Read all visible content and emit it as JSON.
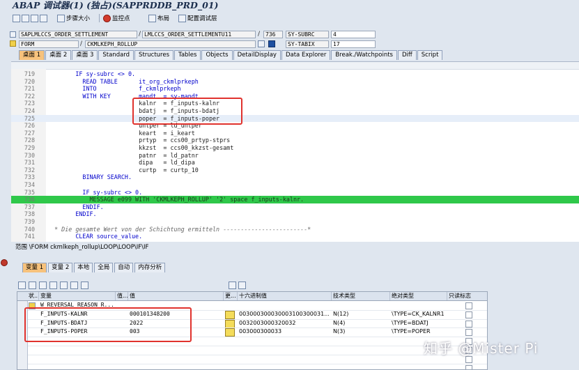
{
  "window": {
    "title": "ABAP 调试器(1) (独占)(SAPPRDDB_PRD_01)"
  },
  "toolbar": {
    "step_size": "步骤大小",
    "watchpoint": "监控点",
    "layout": "布局",
    "config_layer": "配置调试层"
  },
  "fields": {
    "program": "SAPLMLCCS_ORDER_SETTLEMENT",
    "include": "LMLCCS_ORDER_SETTLEMENTU11",
    "line": "736",
    "sysubrc_label": "SY-SUBRC",
    "sysubrc_value": "4",
    "event_type": "FORM",
    "event_name": "CKMLKEPH_ROLLUP",
    "sytabix_label": "SY-TABIX",
    "sytabix_value": "17"
  },
  "tabs": [
    "桌面 1",
    "桌面 2",
    "桌面 3",
    "Standard",
    "Structures",
    "Tables",
    "Objects",
    "DetailDisplay",
    "Data Explorer",
    "Break./Watchpoints",
    "Diff",
    "Script"
  ],
  "code_lines": [
    {
      "n": "719",
      "text": "        IF sy-subrc <> 0."
    },
    {
      "n": "720",
      "text": "          READ TABLE      it_org_ckmlprkeph"
    },
    {
      "n": "721",
      "text": "          INTO            f_ckmlprkeph"
    },
    {
      "n": "722",
      "text": "          WITH KEY        mandt  = sy-mandt"
    },
    {
      "n": "723",
      "text": "                          kalnr  = f_inputs-kalnr"
    },
    {
      "n": "724",
      "text": "                          bdatj  = f_inputs-bdatj"
    },
    {
      "n": "725",
      "text": "                          poper  = f_inputs-poper"
    },
    {
      "n": "726",
      "text": "                          untper = ld_untper"
    },
    {
      "n": "727",
      "text": "                          keart  = i_keart"
    },
    {
      "n": "728",
      "text": "                          prtyp  = ccs00_prtyp-stprs"
    },
    {
      "n": "729",
      "text": "                          kkzst  = ccs00_kkzst-gesamt"
    },
    {
      "n": "730",
      "text": "                          patnr  = ld_patnr"
    },
    {
      "n": "731",
      "text": "                          dipa   = ld_dipa"
    },
    {
      "n": "732",
      "text": "                          curtp  = curtp_10"
    },
    {
      "n": "733",
      "text": "          BINARY SEARCH."
    },
    {
      "n": "734",
      "text": ""
    },
    {
      "n": "735",
      "text": "          IF sy-subrc <> 0."
    },
    {
      "n": "736",
      "text": "            MESSAGE e099 WITH 'CKMLKEPH_ROLLUP' '2' space f_inputs-kalnr."
    },
    {
      "n": "737",
      "text": "          ENDIF."
    },
    {
      "n": "738",
      "text": "        ENDIF."
    },
    {
      "n": "739",
      "text": ""
    },
    {
      "n": "740",
      "text": "  * Die gesamte Wert von der Schichtung ermitteln ------------------------*"
    },
    {
      "n": "741",
      "text": "        CLEAR source_value."
    }
  ],
  "status": {
    "scope": "范围 \\FORM ckmlkeph_rollup\\LOOP\\LOOP\\IF\\IF"
  },
  "var_tabs": [
    "变量 1",
    "变量 2",
    "本地",
    "全局",
    "自动",
    "内存分析"
  ],
  "grid": {
    "headers": [
      "状...",
      "变量",
      "值...",
      "值",
      "更...",
      "十六进制值",
      "技术类型",
      "绝对类型",
      "只读标志"
    ],
    "rows": [
      {
        "var": "W_REVERSAL_REASON_R...",
        "val": "",
        "hex": "",
        "tech": "",
        "abs": ""
      },
      {
        "var": "F_INPUTS-KALNR",
        "val": "000101348200",
        "hex": "003000300030003100300031...",
        "tech": "N(12)",
        "abs": "\\TYPE=CK_KALNR1"
      },
      {
        "var": "F_INPUTS-BDATJ",
        "val": "2022",
        "hex": "0032003000320032",
        "tech": "N(4)",
        "abs": "\\TYPE=BDATJ"
      },
      {
        "var": "F_INPUTS-POPER",
        "val": "003",
        "hex": "003000300033",
        "tech": "N(3)",
        "abs": "\\TYPE=POPER"
      },
      {
        "var": "",
        "val": "",
        "hex": "",
        "tech": "",
        "abs": ""
      },
      {
        "var": "",
        "val": "",
        "hex": "",
        "tech": "",
        "abs": ""
      },
      {
        "var": "",
        "val": "",
        "hex": "",
        "tech": "",
        "abs": ""
      },
      {
        "var": "",
        "val": "",
        "hex": "",
        "tech": "",
        "abs": ""
      }
    ]
  },
  "watermark": "知乎 @Mister Pi",
  "colors": {
    "accent_tab": "#f7c27c",
    "exec_line": "#2fc84a",
    "annotation": "#e0322d"
  }
}
